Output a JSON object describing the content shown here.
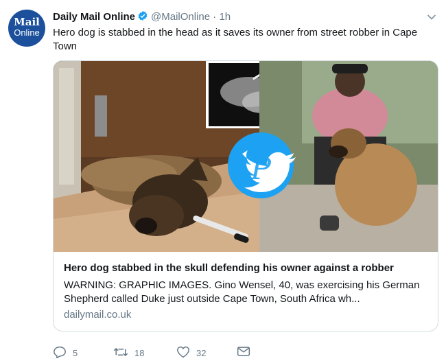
{
  "avatar": {
    "line1": "Mail",
    "line2": "Online"
  },
  "author": {
    "name": "Daily Mail Online",
    "handle": "@MailOnline",
    "separator": "·",
    "time": "1h"
  },
  "tweet": {
    "text": "Hero dog is stabbed in the head as it saves its owner from street robber in Cape Town"
  },
  "card": {
    "title": "Hero dog stabbed in the skull defending his owner against a robber",
    "description": "WARNING: GRAPHIC IMAGES. Gino Wensel, 40, was exercising his German Shepherd called Duke just outside Cape Town, South Africa wh...",
    "domain": "dailymail.co.uk"
  },
  "actions": {
    "replies": "5",
    "retweets": "18",
    "likes": "32"
  },
  "icons": [
    "verified-badge-icon",
    "chevron-down-icon",
    "reply-icon",
    "retweet-icon",
    "like-icon",
    "direct-message-icon",
    "twitter-bird-watermark-icon"
  ],
  "colors": {
    "avatar": "#1c4f9c",
    "verified": "#1da1f2",
    "secondary_text": "#657786",
    "watermark": "#1da1f2"
  }
}
